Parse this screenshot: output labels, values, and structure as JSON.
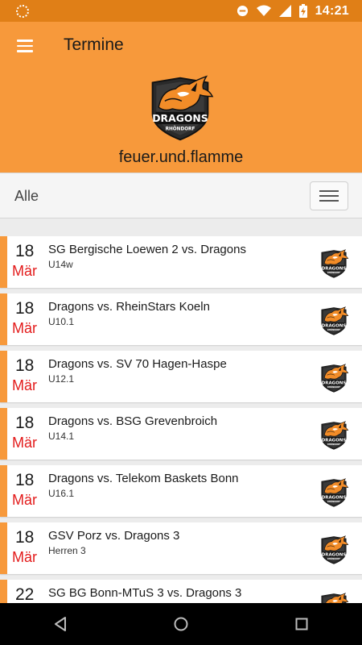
{
  "status_bar": {
    "time": "14:21",
    "icons": [
      "do-not-disturb-icon",
      "wifi-icon",
      "signal-icon",
      "battery-charging-icon"
    ]
  },
  "app_bar": {
    "title": "Termine",
    "menu_icon": "hamburger-menu-icon"
  },
  "header": {
    "logo_text": "DRAGONS",
    "logo_subtext": "RHÖNDORF",
    "tagline": "feuer.und.flamme"
  },
  "filter": {
    "selected": "Alle",
    "toggle_icon": "hamburger-menu-icon"
  },
  "events": [
    {
      "day": "18",
      "month": "Mär",
      "title": "SG Bergische Loewen 2 vs. Dragons",
      "team": "U14w"
    },
    {
      "day": "18",
      "month": "Mär",
      "title": "Dragons vs. RheinStars Koeln",
      "team": "U10.1"
    },
    {
      "day": "18",
      "month": "Mär",
      "title": "Dragons vs. SV 70 Hagen-Haspe",
      "team": "U12.1"
    },
    {
      "day": "18",
      "month": "Mär",
      "title": "Dragons vs. BSG Grevenbroich",
      "team": "U14.1"
    },
    {
      "day": "18",
      "month": "Mär",
      "title": "Dragons vs. Telekom Baskets Bonn",
      "team": "U16.1"
    },
    {
      "day": "18",
      "month": "Mär",
      "title": "GSV Porz vs. Dragons 3",
      "team": "Herren 3"
    },
    {
      "day": "22",
      "month": "",
      "title": "SG BG Bonn-MTuS 3 vs. Dragons 3",
      "team": ""
    }
  ],
  "colors": {
    "accent": "#f7993b",
    "status_bar": "#e07f17",
    "month_red": "#e31b1b"
  },
  "nav_bar": [
    "back-icon",
    "home-icon",
    "recents-icon"
  ]
}
